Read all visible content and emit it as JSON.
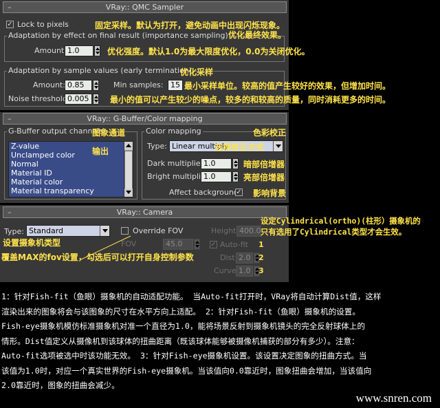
{
  "qmc": {
    "title": "VRay:: QMC Sampler",
    "lock_pixels_label": "Lock to pixels",
    "lock_pixels_checked": true,
    "adapt_effect_group": "Adaptation by effect on final result (importance sampling)",
    "amount_label": "Amount:",
    "amount_value": "1.0",
    "adapt_values_group": "Adaptation by sample values (early termination)",
    "amount2_label": "Amount:",
    "amount2_value": "0.85",
    "min_samples_label": "Min samples:",
    "min_samples_value": "15",
    "noise_label": "Noise threshold:",
    "noise_value": "0.005"
  },
  "gbuffer": {
    "title": "VRay:: G-Buffer/Color mapping",
    "channels_group": "G-Buffer output channels",
    "channels": [
      "Z-value",
      "Unclamped color",
      "Normal",
      "Material ID",
      "Material color",
      "Material transparency"
    ],
    "color_mapping_group": "Color mapping",
    "type_label": "Type:",
    "type_value": "Linear multiply",
    "dark_label": "Dark multiplier:",
    "dark_value": "1.0",
    "bright_label": "Bright multiplier:",
    "bright_value": "1.0",
    "affect_bg_label": "Affect background",
    "affect_bg_checked": true
  },
  "camera": {
    "title": "VRay:: Camera",
    "type_label": "Type:",
    "type_value": "Standard",
    "override_fov_label": "Override FOV",
    "fov_label": "FOV",
    "fov_value": "45.0",
    "height_label": "Height",
    "height_value": "400.0",
    "autofit_label": "Auto-fit",
    "dist_label": "Dist",
    "dist_value": "2.0",
    "curve_label": "Curve",
    "curve_value": "1.0"
  },
  "annotations": {
    "lock": "固定采样。默认为打开，避免动画中出现闪烁现象。",
    "optimize": "优化最终效果。",
    "amount": "优化强度。默认1.0为最大限度优化，0.0为关闭优化。",
    "optimize_sample": "优化采样",
    "min_samples": "最小采样单位。较高的值产生较好的效果，但增加时间。",
    "noise": "最小的值可以产生较少的噪点，较多的和较高的质量，同时消耗更多的时间。",
    "gbuffer_channels": "图象通道",
    "output": "输出",
    "color_correct": "色彩校正",
    "select_method": "选择校正方式",
    "dark": "暗部倍增器",
    "bright": "亮部倍增器",
    "affect_bg": "影响背景",
    "cylindrical": "设定Cylindrical(ortho)(柱形）摄象机的\n只有选用了Cylindrical类型才会生效。",
    "camera_type": "设置摄象机类型",
    "override_fov": "覆盖MAX的fov设置，勾选后可以打开自身控制参数",
    "num1": "1",
    "num2": "2",
    "num3": "3"
  },
  "description": [
    "1：针对Fish-fit（鱼眼）摄象机的自动适配功能。 当Auto-fit打开时，VRay将自动计算Dist值，这样",
    "渲染出来的图象将会与该图象的尺寸在水平方向上适配。        2：针对Fish-fit（鱼眼）摄象机的设置。",
    "Fish-eye摄象机模仿标准摄象机对准一个直径为1.0，能将场景反射到摄象机镜头的完全反射球体上的",
    "情形。Dist值定义从摄像机到该球体的扭曲距离（既该球体能够被摄像机捕获的部分有多少）。注意：",
    "Auto-fit选项被选中时该功能无效。     3：针对Fish-eye摄象机设置。该设置决定图象的扭曲方式。当",
    "该值为1.0时，对应一个真实世界的Fish-eye摄象机。当该值向0.0靠近时，图象扭曲会增加，当该值向",
    "2.0靠近时，图象的扭曲会减少。"
  ],
  "site": "www.snren.com"
}
